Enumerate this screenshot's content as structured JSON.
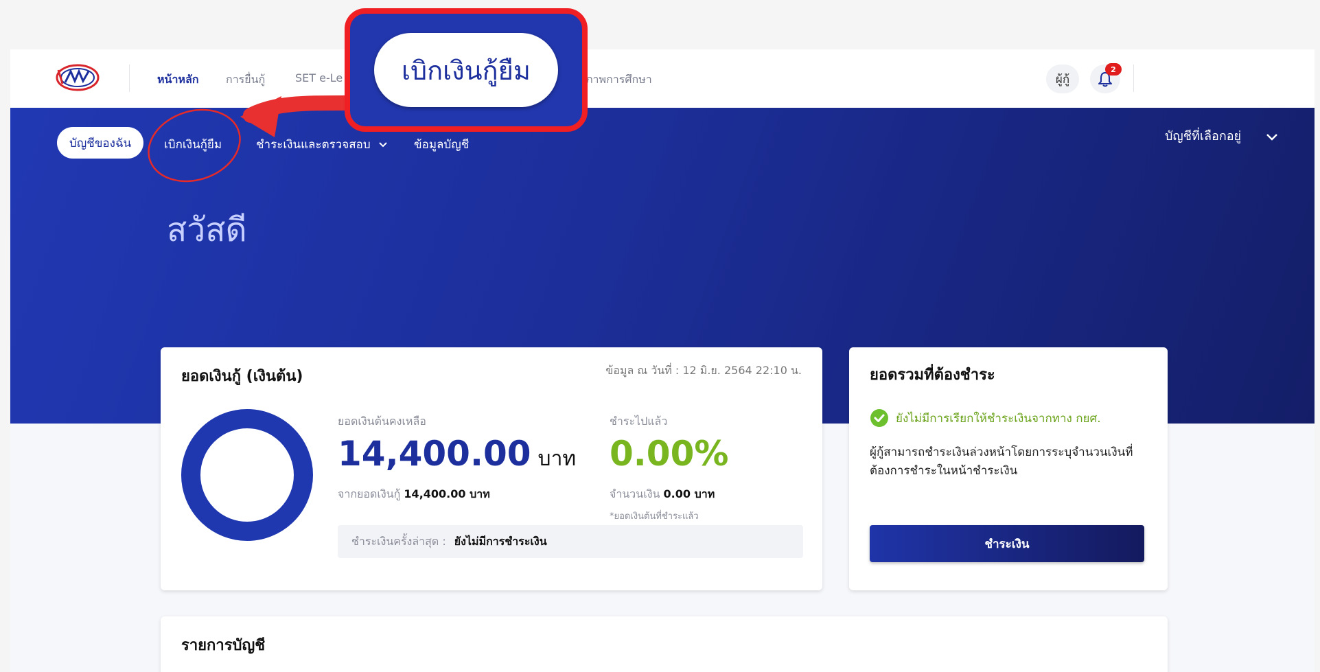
{
  "topnav": {
    "items": [
      "หน้าหลัก",
      "การยื่นกู้",
      "SET e-Le",
      "ภาพการศึกษา"
    ],
    "user_label": "ผู้กู้",
    "notification_count": "2"
  },
  "subnav": {
    "my_account": "บัญชีของฉัน",
    "withdraw": "เบิกเงินกู้ยืม",
    "payments": "ชำระเงินและตรวจสอบ",
    "account_info": "ข้อมูลบัญชี",
    "selected_account": "บัญชีที่เลือกอยู่"
  },
  "greeting": "สวัสดี",
  "loan_card": {
    "title": "ยอดเงินกู้ (เงินต้น)",
    "data_date": "ข้อมูล ณ วันที่ : 12 มิ.ย. 2564 22:10 น.",
    "remaining_label": "ยอดเงินต้นคงเหลือ",
    "remaining_amount": "14,400.00",
    "unit": "บาท",
    "from_total_label": "จากยอดเงินกู้",
    "from_total_value": "14,400.00 บาท",
    "paid_label": "ชำระไปแล้ว",
    "paid_percent": "0.00%",
    "amount_label": "จำนวนเงิน",
    "amount_value": "0.00 บาท",
    "paid_note": "*ยอดเงินต้นที่ชำระแล้ว",
    "last_pay_label": "ชำระเงินครั้งล่าสุด :",
    "last_pay_value": "ยังไม่มีการชำระเงิน",
    "remaining_fraction": 1.0
  },
  "due_card": {
    "title": "ยอดรวมที่ต้องชำระ",
    "status": "ยังไม่มีการเรียกให้ชำระเงินจากทาง กยศ.",
    "description": "ผู้กู้สามารถชำระเงินล่วงหน้าโดยการระบุจำนวนเงินที่ต้องการชำระในหน้าชำระเงิน",
    "pay_button": "ชำระเงิน"
  },
  "list_card": {
    "title": "รายการบัญชี"
  },
  "callout": {
    "label": "เบิกเงินกู้ยืม"
  },
  "colors": {
    "brand_blue": "#1c2f9d",
    "highlight_red": "#ef1f24",
    "success_green": "#78b51f"
  }
}
